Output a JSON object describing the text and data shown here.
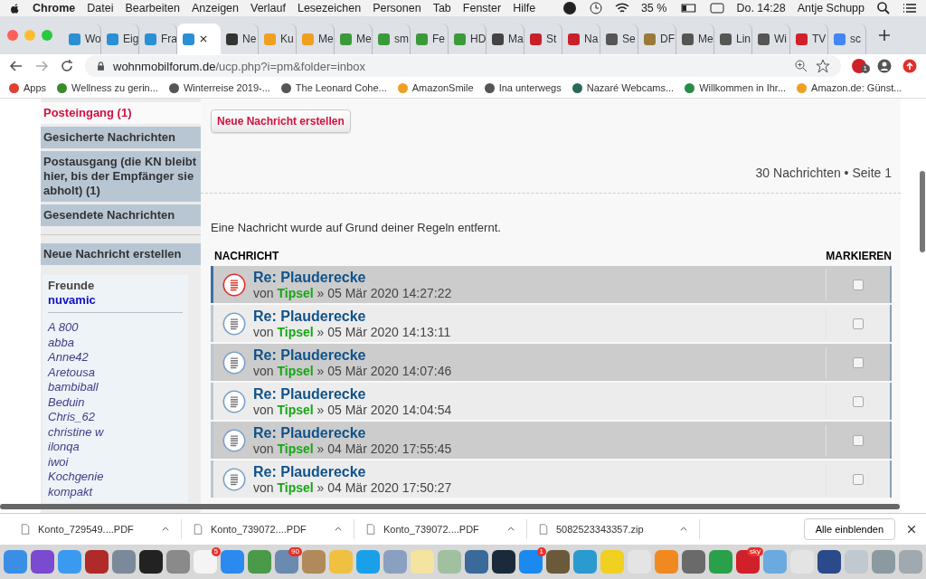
{
  "menubar": {
    "app": "Chrome",
    "menus": [
      "Datei",
      "Bearbeiten",
      "Anzeigen",
      "Verlauf",
      "Lesezeichen",
      "Personen",
      "Tab",
      "Fenster",
      "Hilfe"
    ],
    "battery": "35 %",
    "clock": "Do. 14:28",
    "user": "Antje Schupp"
  },
  "tabs": [
    {
      "label": "Wo",
      "selected": false,
      "color": "#2a8fd6"
    },
    {
      "label": "Eig",
      "selected": false,
      "color": "#2a8fd6"
    },
    {
      "label": "Fra",
      "selected": false,
      "color": "#2a8fd6"
    },
    {
      "selected": true,
      "color": "#2a8fd6"
    },
    {
      "label": "Ne",
      "selected": false,
      "color": "#333333"
    },
    {
      "label": "Ku",
      "selected": false,
      "color": "#f0a020"
    },
    {
      "label": "Me",
      "selected": false,
      "color": "#f0a020"
    },
    {
      "label": "Me",
      "selected": false,
      "color": "#3a9a3a"
    },
    {
      "label": "sm",
      "selected": false,
      "color": "#3a9a3a"
    },
    {
      "label": "Fe",
      "selected": false,
      "color": "#3a9a3a"
    },
    {
      "label": "HD",
      "selected": false,
      "color": "#3a9a3a"
    },
    {
      "label": "Ma",
      "selected": false,
      "color": "#444444"
    },
    {
      "label": "St",
      "selected": false,
      "color": "#c8202a"
    },
    {
      "label": "Na",
      "selected": false,
      "color": "#c8202a"
    },
    {
      "label": "Se",
      "selected": false,
      "color": "#555555"
    },
    {
      "label": "DF",
      "selected": false,
      "color": "#9a7a3a"
    },
    {
      "label": "Me",
      "selected": false,
      "color": "#555555"
    },
    {
      "label": "Lin",
      "selected": false,
      "color": "#555555"
    },
    {
      "label": "Wi",
      "selected": false,
      "color": "#555555"
    },
    {
      "label": "TV",
      "selected": false,
      "color": "#d0202a"
    },
    {
      "label": "sc",
      "selected": false,
      "color": "#4285f4"
    }
  ],
  "address": {
    "host": "wohnmobilforum.de",
    "path": "/ucp.php?i=pm&folder=inbox",
    "extension_badge": "1"
  },
  "bookmarks": [
    {
      "label": "Apps",
      "color": "#e04030"
    },
    {
      "label": "Wellness zu gerin...",
      "color": "#3a8a2a"
    },
    {
      "label": "Winterreise 2019-...",
      "color": "#555555"
    },
    {
      "label": "The Leonard Cohe...",
      "color": "#555555"
    },
    {
      "label": "AmazonSmile",
      "color": "#f0a020"
    },
    {
      "label": "Ina unterwegs",
      "color": "#555555"
    },
    {
      "label": "Nazaré Webcams...",
      "color": "#2a6a5a"
    },
    {
      "label": "Willkommen in Ihr...",
      "color": "#2a8a4a"
    },
    {
      "label": "Amazon.de: Günst...",
      "color": "#f0a020"
    }
  ],
  "sidebar": {
    "folders": [
      {
        "label": "Posteingang (1)",
        "selected": true
      },
      {
        "label": "Gesicherte Nachrichten",
        "selected": false
      },
      {
        "label": "Postausgang (die KN bleibt hier, bis der Empfänger sie abholt) (1)",
        "selected": false
      },
      {
        "label": "Gesendete Nachrichten",
        "selected": false
      }
    ],
    "compose": "Neue Nachricht erstellen",
    "friends": {
      "title": "Freunde",
      "online": [
        "nuvamic"
      ],
      "offline": [
        "A 800",
        "abba",
        "Anne42",
        "Aretousa",
        "bambiball",
        "Beduin",
        "Chris_62",
        "christine w",
        "ilonqa",
        "iwoi",
        "Kochgenie",
        "kompakt"
      ]
    }
  },
  "main": {
    "compose_button": "Neue Nachricht erstellen",
    "pagination": "30 Nachrichten • Seite 1",
    "notice": "Eine Nachricht wurde auf Grund deiner Regeln entfernt.",
    "columns": [
      "NACHRICHT",
      "MARKIEREN"
    ],
    "rows": [
      {
        "subject": "Re: Plauderecke",
        "by": "von",
        "author": "Tipsel",
        "date": "» 05 Mär 2020 14:27:22",
        "unread": true,
        "checked": false
      },
      {
        "subject": "Re: Plauderecke",
        "by": "von",
        "author": "Tipsel",
        "date": "» 05 Mär 2020 14:13:11",
        "unread": false,
        "checked": false
      },
      {
        "subject": "Re: Plauderecke",
        "by": "von",
        "author": "Tipsel",
        "date": "» 05 Mär 2020 14:07:46",
        "unread": false,
        "checked": false
      },
      {
        "subject": "Re: Plauderecke",
        "by": "von",
        "author": "Tipsel",
        "date": "» 05 Mär 2020 14:04:54",
        "unread": false,
        "checked": false
      },
      {
        "subject": "Re: Plauderecke",
        "by": "von",
        "author": "Tipsel",
        "date": "» 04 Mär 2020 17:55:45",
        "unread": false,
        "checked": false
      },
      {
        "subject": "Re: Plauderecke",
        "by": "von",
        "author": "Tipsel",
        "date": "» 04 Mär 2020 17:50:27",
        "unread": false,
        "checked": false
      }
    ]
  },
  "downloads": {
    "items": [
      "Konto_729549....PDF",
      "Konto_739072....PDF",
      "Konto_739072....PDF",
      "5082523343357.zip"
    ],
    "show_all": "Alle einblenden"
  },
  "dock": [
    {
      "color": "#3a8ee6"
    },
    {
      "color": "#7a4ad0"
    },
    {
      "color": "#3a9af0"
    },
    {
      "color": "#b02a2a"
    },
    {
      "color": "#7a8a9a"
    },
    {
      "color": "#222222"
    },
    {
      "color": "#8a8a8a"
    },
    {
      "color": "#f4f4f4",
      "badge": "5"
    },
    {
      "color": "#2a8af0"
    },
    {
      "color": "#4a9a4a"
    },
    {
      "color": "#6a8ab0",
      "badge": "90"
    },
    {
      "color": "#b08a5a"
    },
    {
      "color": "#f0c040"
    },
    {
      "color": "#1aa0e8"
    },
    {
      "color": "#8aa0c0"
    },
    {
      "color": "#f4e4a0"
    },
    {
      "color": "#a0c0a0"
    },
    {
      "color": "#3a6a9a"
    },
    {
      "color": "#1a2a3a"
    },
    {
      "color": "#1a8af0",
      "badge": "1"
    },
    {
      "color": "#6a5a3a"
    },
    {
      "color": "#2a9ad0"
    },
    {
      "color": "#f0d020"
    },
    {
      "color": "#e4e4e4"
    },
    {
      "color": "#f08a20"
    },
    {
      "color": "#6a6a6a"
    },
    {
      "color": "#2aa04a"
    },
    {
      "color": "#d0202a",
      "badge": "sky"
    },
    {
      "color": "#6aaae0"
    },
    {
      "color": "#e4e4e4"
    },
    {
      "color": "#2a4a8a"
    },
    {
      "color": "#c0c8d0"
    },
    {
      "color": "#8a9aa0"
    },
    {
      "color": "#a0a8b0"
    }
  ]
}
